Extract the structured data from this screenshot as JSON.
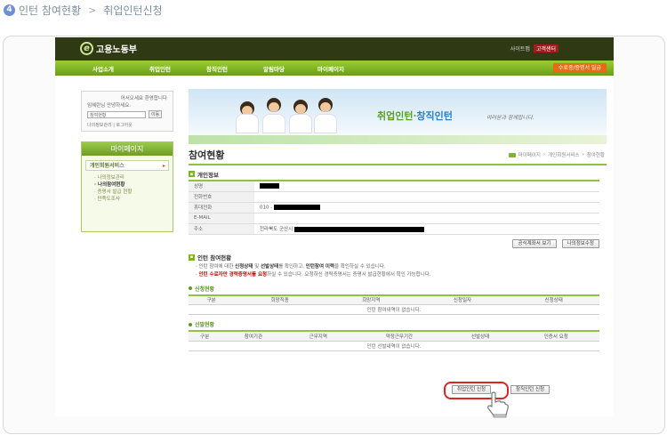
{
  "tutorial": {
    "step": "4",
    "crumb1": "인턴 참여현황",
    "crumb2": "취업인턴신청"
  },
  "site": {
    "logo": "고용노동부",
    "toplinks": [
      "사이트맵",
      "고객센터"
    ],
    "nav": [
      "사업소개",
      "취업인턴",
      "창직인턴",
      "알림마당",
      "마이페이지"
    ],
    "nav_button": "수료증/증명서 발급"
  },
  "login": {
    "greeting_line1": "어서오세요 환영합니다",
    "greeting_line2": "임혜란님 안녕하세요.",
    "select_value": "참여현황",
    "go_button": "이동",
    "link_mypage": "나의정보관리",
    "link_logout": "로그아웃"
  },
  "side_menu": {
    "title": "마이페이지",
    "subtitle": "개인회원서비스",
    "items": [
      "나의정보관리",
      "나의참여현황",
      "증명서 발급 현황",
      "만족도조사"
    ],
    "active_index": 1
  },
  "banner": {
    "slogan_part1": "취업인턴",
    "slogan_sep": "·",
    "slogan_part2": "창직인턴",
    "slogan_sub": "여러분과 함께합니다."
  },
  "page": {
    "title": "참여현황",
    "breadcrumb": [
      "마이페이지",
      "개인회원서비스",
      "참여현황"
    ]
  },
  "personal": {
    "heading": "개인정보",
    "rows": [
      {
        "label": "성명",
        "value": ""
      },
      {
        "label": "전화번호",
        "value": ""
      },
      {
        "label": "휴대전화",
        "value": "010 -"
      },
      {
        "label": "E-MAIL",
        "value": ""
      },
      {
        "label": "주소",
        "value": "전라북도 군산시"
      }
    ],
    "buttons": [
      "공식계좌서 보기",
      "나의정보수정"
    ]
  },
  "status": {
    "heading": "인턴 참여현황",
    "note1_pre": "인턴 참여에 대한 ",
    "note1_b1": "신청상태",
    "note1_mid": " 및 ",
    "note1_b2": "선발상태",
    "note1_mid2": "를 확인하고, ",
    "note1_b3": "인턴참여 이력",
    "note1_post": "을 확인하실 수 있습니다.",
    "note2_red": "인턴 수료자만 경력증명서를 요청",
    "note2_post": "하실 수 있습니다. 요청하신 경력증명서는 증명서 발급현황에서 확인 가능합니다."
  },
  "applications": {
    "heading": "신청현황",
    "columns": [
      "구분",
      "희망직종",
      "희망지역",
      "신청일자",
      "신청상태"
    ],
    "empty": "인턴 참여내역이 없습니다."
  },
  "selections": {
    "heading": "선발현황",
    "columns": [
      "구분",
      "참여기관",
      "근무지역",
      "약정근무기간",
      "선발상태",
      "인증서 요청"
    ],
    "empty": "인턴 선발내역이 없습니다.",
    "buttons": [
      "취업인턴 신청",
      "창직인턴 신청"
    ]
  },
  "colors": {
    "accent_green": "#8fc23d",
    "highlight_red": "#e02222"
  }
}
